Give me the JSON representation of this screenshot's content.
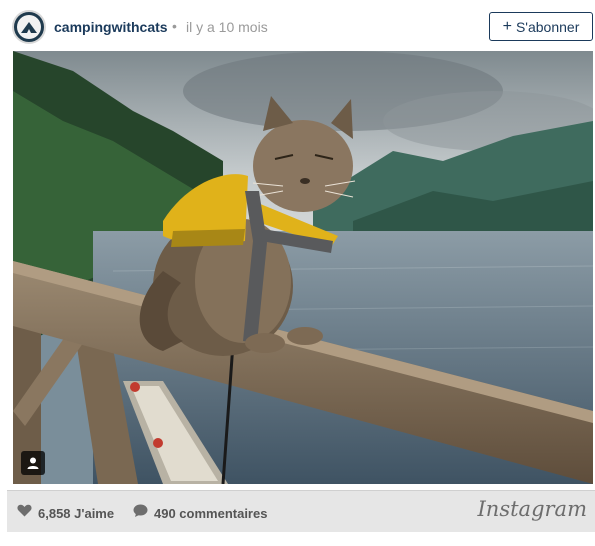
{
  "header": {
    "username": "campingwithcats",
    "separator": "•",
    "time_ago": "il y a 10 mois",
    "follow_plus": "+",
    "follow_label": "S'abonner"
  },
  "post": {
    "image_alt": "",
    "user_tag_icon": "person-icon"
  },
  "footer": {
    "likes": "6,858 J'aime",
    "comments": "490 commentaires",
    "brand": "Instagram"
  },
  "colors": {
    "brand_navy": "#1b3a5b",
    "muted_text": "#9a9a9a",
    "footer_bg": "#e6e6e6"
  }
}
